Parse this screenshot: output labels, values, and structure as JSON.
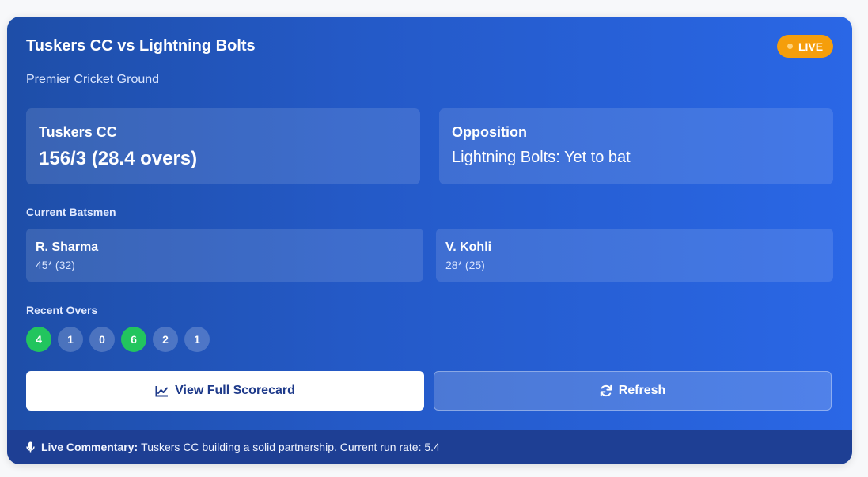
{
  "match": {
    "title": "Tuskers CC vs Lightning Bolts",
    "live_label": "LIVE",
    "venue": "Premier Cricket Ground"
  },
  "home_team": {
    "name": "Tuskers CC",
    "score": "156/3 (28.4 overs)"
  },
  "opposition": {
    "label": "Opposition",
    "status": "Lightning Bolts: Yet to bat"
  },
  "batsmen": {
    "label": "Current Batsmen",
    "items": [
      {
        "name": "R. Sharma",
        "stats": "45* (32)"
      },
      {
        "name": "V. Kohli",
        "stats": "28* (25)"
      }
    ]
  },
  "recent_overs": {
    "label": "Recent Overs",
    "balls": [
      "4",
      "1",
      "0",
      "6",
      "2",
      "1"
    ]
  },
  "actions": {
    "scorecard_label": "View Full Scorecard",
    "refresh_label": "Refresh"
  },
  "commentary": {
    "label": "Live Commentary:",
    "text": "Tuskers CC building a solid partnership. Current run rate: 5.4"
  },
  "colors": {
    "live_badge": "#f59e0b",
    "boundary_ball": "#22c55e",
    "card_gradient_start": "#1e4ea8",
    "card_gradient_end": "#2a67e6"
  },
  "icons": {
    "scorecard": "chart-line-icon",
    "refresh": "refresh-icon",
    "commentary": "microphone-icon"
  }
}
